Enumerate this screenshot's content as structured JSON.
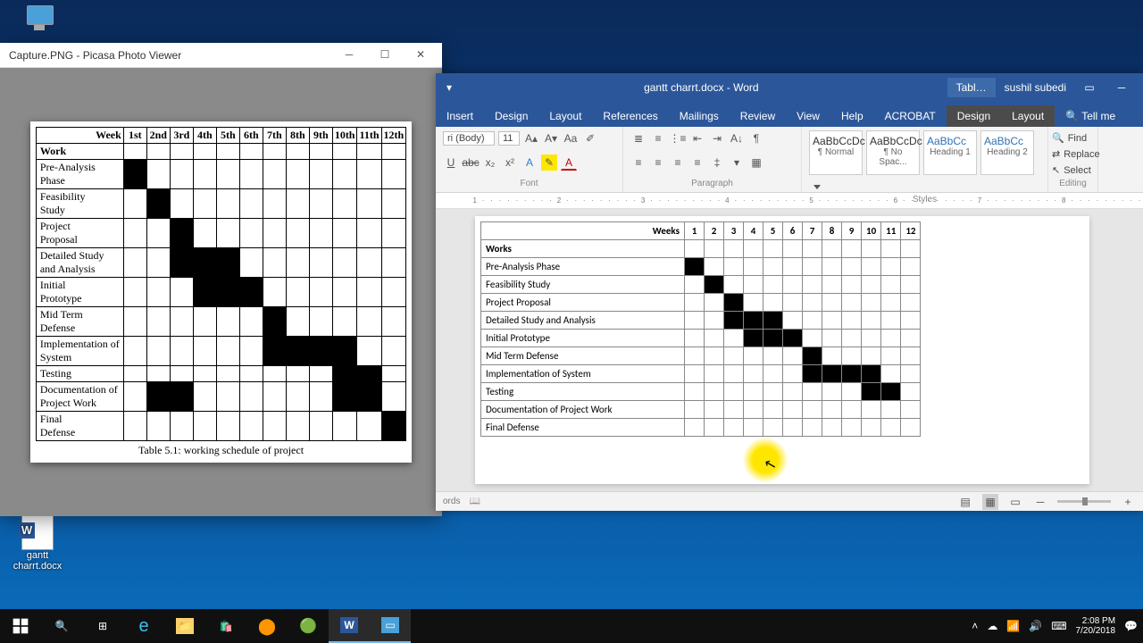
{
  "desktop": {
    "icons": [
      {
        "name": "this-pc",
        "label": ""
      },
      {
        "name": "gantt-doc",
        "label": "gantt\ncharrt.docx"
      }
    ]
  },
  "photo_viewer": {
    "title": "Capture.PNG - Picasa Photo Viewer",
    "caption": "Table 5.1: working schedule of project",
    "header_first": "Week",
    "work_row_label": "Work",
    "weeks": [
      "1st",
      "2nd",
      "3rd",
      "4th",
      "5th",
      "6th",
      "7th",
      "8th",
      "9th",
      "10th",
      "11th",
      "12th"
    ]
  },
  "word": {
    "title": "gantt charrt.docx - Word",
    "context_tab": "Tabl…",
    "user": "sushil subedi",
    "tell_me": "Tell me",
    "tabs": [
      "Insert",
      "Design",
      "Layout",
      "References",
      "Mailings",
      "Review",
      "View",
      "Help",
      "ACROBAT",
      "Design",
      "Layout"
    ],
    "font_name": "ri (Body)",
    "font_size": "11",
    "groups": {
      "font": "Font",
      "paragraph": "Paragraph",
      "styles": "Styles",
      "editing": "Editing"
    },
    "styles": [
      {
        "preview": "AaBbCcDc",
        "name": "¶ Normal"
      },
      {
        "preview": "AaBbCcDc",
        "name": "¶ No Spac..."
      },
      {
        "preview": "AaBbCc",
        "name": "Heading 1"
      },
      {
        "preview": "AaBbCc",
        "name": "Heading 2"
      }
    ],
    "side": {
      "find": "Find",
      "replace": "Replace",
      "select": "Select"
    },
    "status_words": "ords",
    "doc_weeks_label": "Weeks",
    "doc_works_label": "Works",
    "weeks": [
      "1",
      "2",
      "3",
      "4",
      "5",
      "6",
      "7",
      "8",
      "9",
      "10",
      "11",
      "12"
    ]
  },
  "chart_data": [
    {
      "type": "bar",
      "title": "Table 5.1: working schedule of project",
      "xlabel": "Week",
      "ylabel": "Work",
      "ylim": [
        1,
        12
      ],
      "categories": [
        "Pre-Analysis Phase",
        "Feasibility Study",
        "Project Proposal",
        "Detailed Study and Analysis",
        "Initial Prototype",
        "Mid Term Defense",
        "Implementation of System",
        "Testing",
        "Documentation of Project Work",
        "Final Defense"
      ],
      "series": [
        {
          "name": "filled_weeks",
          "values": [
            [
              1
            ],
            [
              2
            ],
            [
              3
            ],
            [
              3,
              4,
              5
            ],
            [
              4,
              5,
              6
            ],
            [
              7
            ],
            [
              7,
              8,
              9,
              10
            ],
            [
              10,
              11
            ],
            [
              2,
              3,
              10,
              11
            ],
            [
              12
            ]
          ]
        }
      ]
    },
    {
      "type": "bar",
      "title": "gantt chart (Word document)",
      "xlabel": "Weeks",
      "ylabel": "Works",
      "ylim": [
        1,
        12
      ],
      "categories": [
        "Pre-Analysis Phase",
        "Feasibility Study",
        "Project Proposal",
        "Detailed Study and Analysis",
        "Initial Prototype",
        "Mid Term Defense",
        "Implementation of System",
        "Testing",
        "Documentation of Project Work",
        "Final Defense"
      ],
      "series": [
        {
          "name": "filled_weeks",
          "values": [
            [
              1
            ],
            [
              2
            ],
            [
              3
            ],
            [
              3,
              4,
              5
            ],
            [
              4,
              5,
              6
            ],
            [
              7
            ],
            [
              7,
              8,
              9,
              10
            ],
            [
              10,
              11
            ],
            [],
            []
          ]
        }
      ]
    }
  ],
  "taskbar": {
    "time": "2:08 PM",
    "date": "7/20/2018"
  }
}
